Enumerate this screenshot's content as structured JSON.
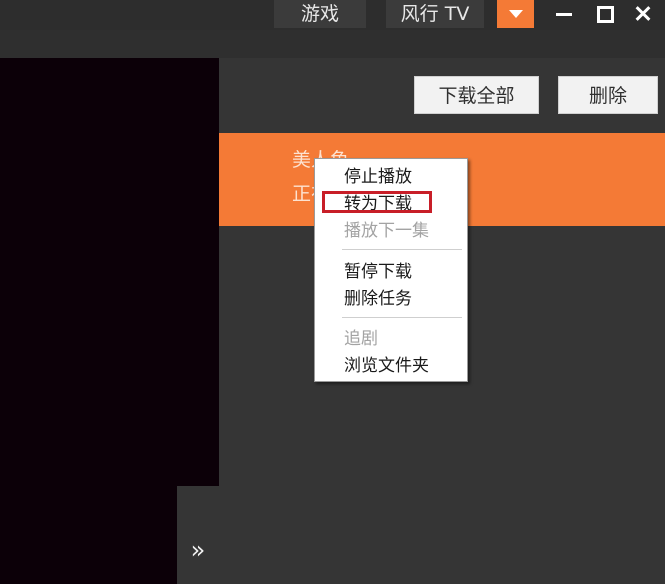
{
  "titlebar": {
    "games_label": "游戏",
    "tv_label": "风行 TV",
    "dropdown_icon": "triangle-down-icon",
    "minimize_icon": "minimize-icon",
    "maximize_icon": "maximize-icon",
    "close_icon": "close-icon"
  },
  "toolbar": {
    "download_all_label": "下载全部",
    "delete_label": "删除"
  },
  "download_item": {
    "title": "美人鱼",
    "status": "正在"
  },
  "sidebar": {
    "expand_label": "»"
  },
  "context_menu": {
    "items": [
      {
        "label": "停止播放",
        "enabled": true
      },
      {
        "label": "转为下载",
        "enabled": true,
        "highlighted": true
      },
      {
        "label": "播放下一集",
        "enabled": false
      },
      {
        "label": "暂停下载",
        "enabled": true
      },
      {
        "label": "删除任务",
        "enabled": true
      },
      {
        "label": "追剧",
        "enabled": false
      },
      {
        "label": "浏览文件夹",
        "enabled": true
      }
    ]
  },
  "colors": {
    "accent": "#f47a36",
    "background": "#2f2f2f",
    "panel": "#353535",
    "video": "#0c0008",
    "highlight_box": "#c81e28"
  }
}
